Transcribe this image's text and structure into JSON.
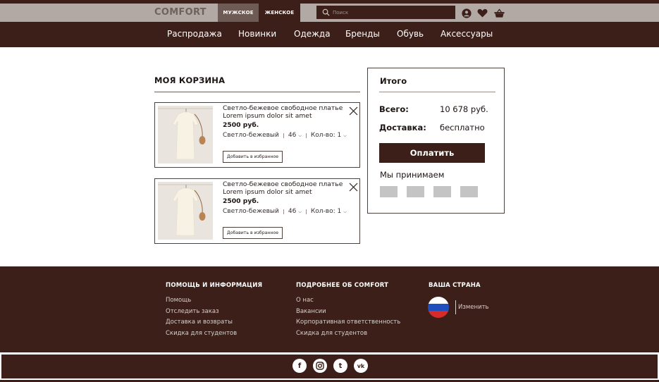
{
  "header": {
    "logo": "COMFORT",
    "tabs": [
      {
        "label": "МУЖСКОЕ",
        "active": true
      },
      {
        "label": "ЖЕНСКОЕ",
        "active": false
      }
    ],
    "search": {
      "placeholder": "Поиск",
      "icon": "search-icon"
    },
    "icons": [
      "user-icon",
      "heart-icon",
      "basket-icon"
    ]
  },
  "nav": {
    "items": [
      "Распродажа",
      "Новинки",
      "Одежда",
      "Бренды",
      "Обувь",
      "Аксессуары"
    ]
  },
  "cart": {
    "title": "МОЯ КОРЗИНА",
    "items": [
      {
        "name_line1": "Светло-бежевое свободное платье",
        "name_line2": "Lorem ipsum dolor sit amet",
        "price": "2500 руб.",
        "color": "Светло-бежевый",
        "size": "46",
        "qty": "Кол-во: 1",
        "fav_label": "Добавить в избранное"
      },
      {
        "name_line1": "Светло-бежевое свободное платье",
        "name_line2": "Lorem ipsum dolor sit amet",
        "price": "2500 руб.",
        "color": "Светло-бежевый",
        "size": "46",
        "qty": "Кол-во: 1",
        "fav_label": "Добавить в избранное"
      }
    ]
  },
  "summary": {
    "title": "Итого",
    "total_label": "Всего:",
    "total_value": "10 678 руб.",
    "delivery_label": "Доставка:",
    "delivery_value": "бесплатно",
    "pay_label": "Оплатить",
    "accept_label": "Мы принимаем"
  },
  "footer": {
    "help": {
      "title": "ПОМОЩЬ И ИНФОРМАЦИЯ",
      "links": [
        "Помощь",
        "Отследить заказ",
        "Доставка и возвраты",
        "Скидка для студентов"
      ]
    },
    "about": {
      "title": "ПОДРОБНЕЕ ОБ COMFORT",
      "links": [
        "О нас",
        "Вакансии",
        "Корпоративная ответственность",
        "Скидка для студентов"
      ]
    },
    "country": {
      "title": "ВАША СТРАНА",
      "change_label": "Изменить"
    },
    "social": [
      {
        "icon": "facebook-icon",
        "glyph": "f"
      },
      {
        "icon": "instagram-icon",
        "glyph": ""
      },
      {
        "icon": "tumblr-icon",
        "glyph": "t"
      },
      {
        "icon": "vk-icon",
        "glyph": "vk"
      }
    ]
  },
  "colors": {
    "brand_dark": "#3b1f18",
    "topbar": "#b3a9a4",
    "active_tab": "#6f5b55"
  }
}
